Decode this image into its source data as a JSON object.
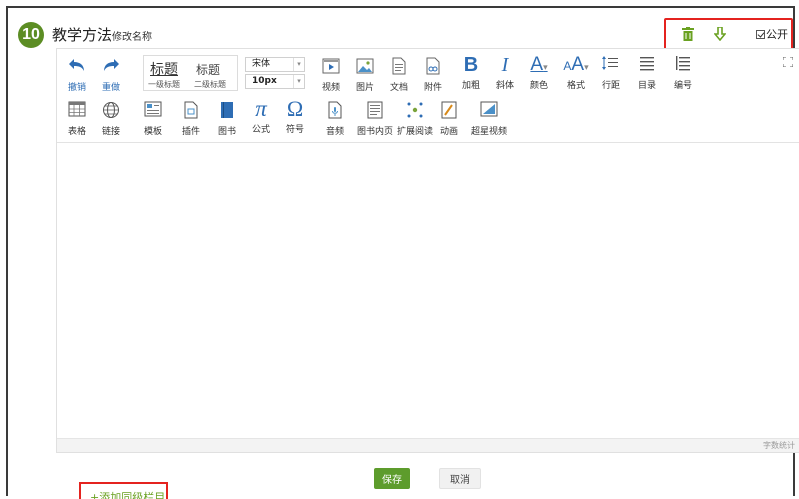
{
  "section": {
    "number": "10",
    "title": "教学方法",
    "rename_label": "修改名称"
  },
  "actions": {
    "delete_icon": "trash-icon",
    "download_icon": "arrow-down-icon",
    "publish_label": "公开",
    "publish_checked": true,
    "accent_color": "#6aa121",
    "highlight_color": "#e4231f"
  },
  "toolbar": {
    "row1": [
      {
        "label": "撤销",
        "icon": "undo-icon",
        "glyph": "↶"
      },
      {
        "label": "重做",
        "icon": "redo-icon",
        "glyph": "↷"
      },
      {
        "label": "视频",
        "icon": "video-icon",
        "glyph": "▶"
      },
      {
        "label": "图片",
        "icon": "image-icon",
        "glyph": "🖼"
      },
      {
        "label": "文档",
        "icon": "document-icon",
        "glyph": "▤"
      },
      {
        "label": "附件",
        "icon": "attachment-icon",
        "glyph": "⊕"
      },
      {
        "label": "加粗",
        "icon": "bold-icon",
        "glyph": "B"
      },
      {
        "label": "斜体",
        "icon": "italic-icon",
        "glyph": "I"
      },
      {
        "label": "颜色",
        "icon": "font-color-icon",
        "glyph": "A"
      },
      {
        "label": "格式",
        "icon": "format-icon",
        "glyph": "A"
      },
      {
        "label": "行距",
        "icon": "line-spacing-icon",
        "glyph": "☰"
      },
      {
        "label": "目录",
        "icon": "toc-icon",
        "glyph": "≡"
      },
      {
        "label": "编号",
        "icon": "numbered-list-icon",
        "glyph": "≣"
      }
    ],
    "heading_style": {
      "title1": "标题",
      "title2": "标题",
      "sub1": "一级标题",
      "sub2": "二级标题"
    },
    "font_family": "宋体",
    "font_size": "10px",
    "row2": [
      {
        "label": "表格",
        "icon": "table-icon",
        "glyph": "▦"
      },
      {
        "label": "链接",
        "icon": "link-icon",
        "glyph": "⊕"
      },
      {
        "label": "模板",
        "icon": "template-icon",
        "glyph": "▤"
      },
      {
        "label": "插件",
        "icon": "plugin-icon",
        "glyph": "▣"
      },
      {
        "label": "图书",
        "icon": "book-icon",
        "glyph": "▮"
      },
      {
        "label": "公式",
        "icon": "formula-icon",
        "glyph": "π"
      },
      {
        "label": "符号",
        "icon": "symbol-icon",
        "glyph": "Ω"
      },
      {
        "label": "音频",
        "icon": "audio-icon",
        "glyph": "♫"
      },
      {
        "label": "图书内页",
        "icon": "book-page-icon",
        "glyph": "▤"
      },
      {
        "label": "扩展阅读",
        "icon": "extended-reading-icon",
        "glyph": "✦"
      },
      {
        "label": "动画",
        "icon": "animation-icon",
        "glyph": "✎"
      },
      {
        "label": "超星视频",
        "icon": "chaoxing-video-icon",
        "glyph": "◢"
      }
    ],
    "fullscreen_icon": "fullscreen-icon"
  },
  "editor": {
    "word_count_label": "字数统计"
  },
  "buttons": {
    "save": "保存",
    "cancel": "取消",
    "save_color": "#5d9c2c"
  },
  "add_section_link": "+添加同级栏目"
}
